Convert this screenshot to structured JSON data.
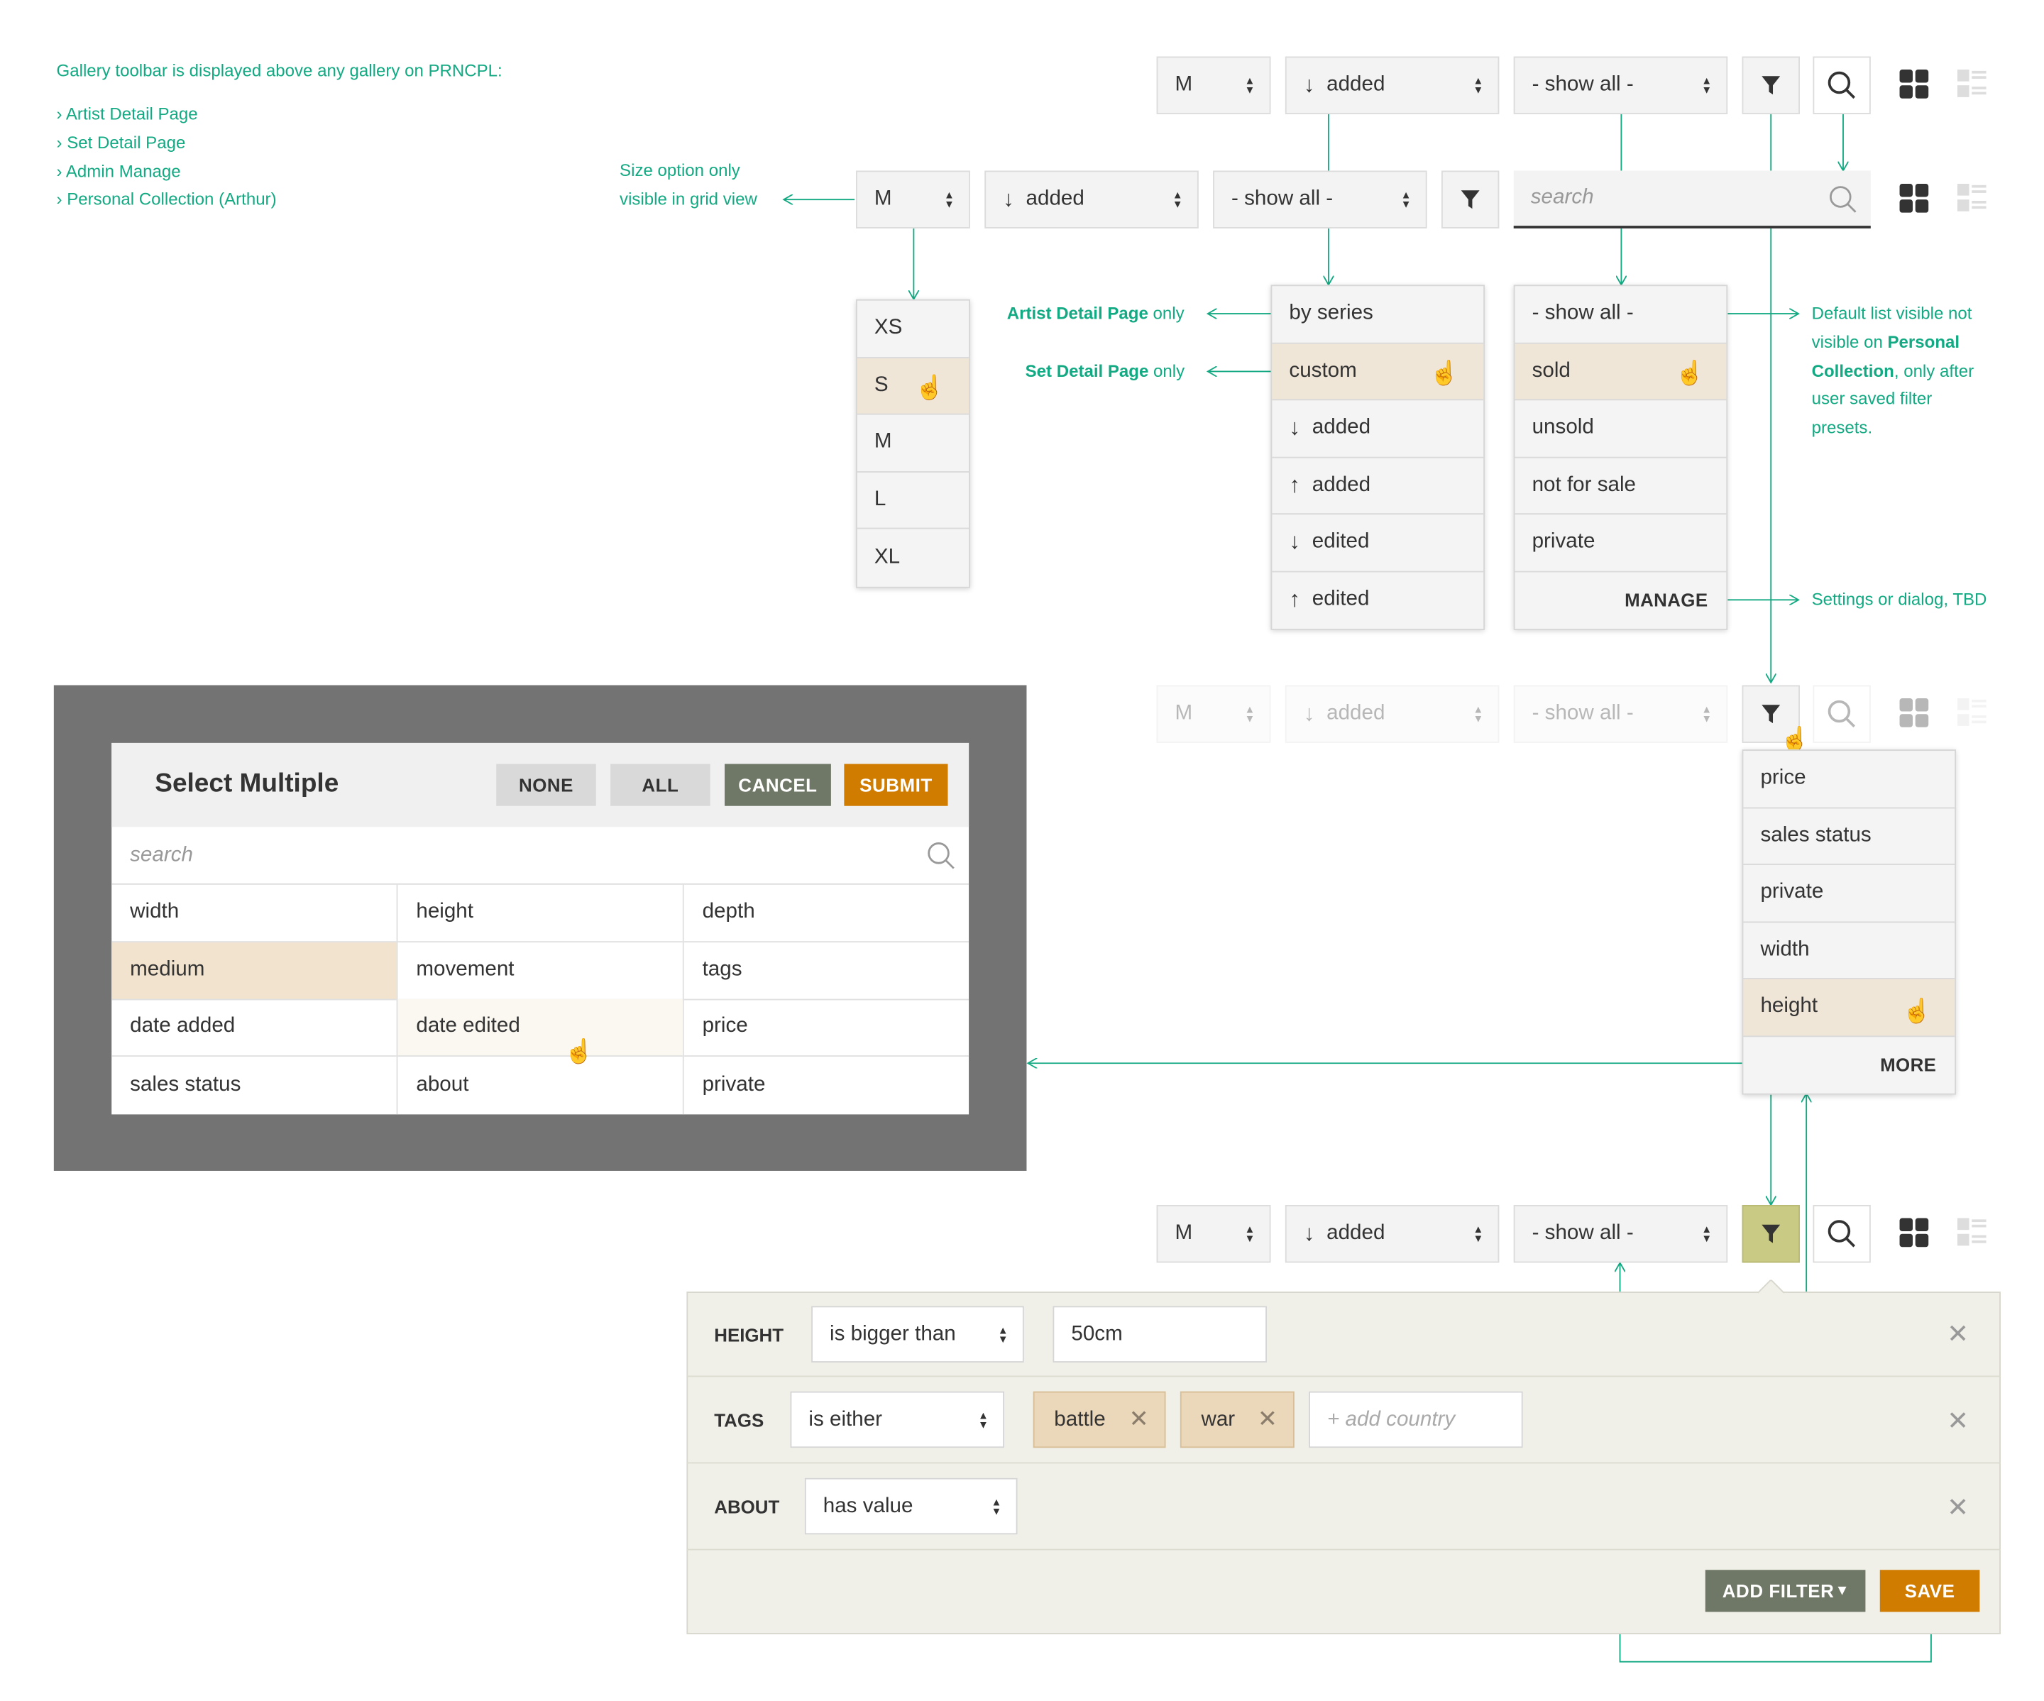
{
  "notes": {
    "gallery_intro": "Gallery toolbar is displayed above any gallery on PRNCPL:",
    "gallery_pages": [
      "› Artist Detail Page",
      "› Set Detail Page",
      "› Admin Manage",
      "› Personal Collection (Arthur)"
    ],
    "size_option_1": "Size option only",
    "size_option_2": "visible in grid view",
    "artist_only_bold": "Artist Detail Page",
    "artist_only_rest": " only",
    "set_only_bold": "Set Detail Page",
    "set_only_rest": " only",
    "default_list_1": "Default list visible not",
    "default_list_2a": "visible on ",
    "default_list_2b": "Personal",
    "default_list_3a": "Collection",
    "default_list_3b": ", only after",
    "default_list_4": "user saved filter",
    "default_list_5": "presets.",
    "settings_dialog": "Settings or dialog, TBD"
  },
  "toolbar": {
    "size_value": "M",
    "sort_value": "added",
    "sort_icon": "arrow-down-icon",
    "show_value": "- show all -",
    "search_placeholder": "search",
    "filter_icon": "funnel-icon",
    "search_icon": "magnifier-icon",
    "grid_icon": "grid-view-icon",
    "list_icon": "list-view-icon",
    "filter_active_color": "#c9cb85"
  },
  "size_dropdown": [
    "XS",
    "S",
    "M",
    "L",
    "XL"
  ],
  "sort_dropdown": [
    {
      "label": "by series",
      "arrow": ""
    },
    {
      "label": "custom",
      "arrow": ""
    },
    {
      "label": "added",
      "arrow": "↓"
    },
    {
      "label": "added",
      "arrow": "↑"
    },
    {
      "label": "edited",
      "arrow": "↓"
    },
    {
      "label": "edited",
      "arrow": "↑"
    }
  ],
  "show_dropdown": {
    "items": [
      "- show all -",
      "sold",
      "unsold",
      "not for sale",
      "private"
    ],
    "manage": "MANAGE"
  },
  "filter_dropdown": {
    "items": [
      "price",
      "sales status",
      "private",
      "width",
      "height"
    ],
    "more": "MORE"
  },
  "select_multiple": {
    "title": "Select Multiple",
    "none": "NONE",
    "all": "ALL",
    "cancel": "CANCEL",
    "submit": "SUBMIT",
    "search_placeholder": "search",
    "cells": [
      "width",
      "height",
      "depth",
      "medium",
      "movement",
      "tags",
      "date added",
      "date edited",
      "price",
      "sales status",
      "about",
      "private"
    ]
  },
  "filter_panel": {
    "rows": [
      {
        "label": "HEIGHT",
        "operator": "is bigger than",
        "value": "50cm"
      },
      {
        "label": "TAGS",
        "operator": "is either",
        "tags": [
          "battle",
          "war"
        ],
        "add_placeholder": "+ add country"
      },
      {
        "label": "ABOUT",
        "operator": "has value"
      }
    ],
    "add_filter": "ADD FILTER",
    "save": "SAVE"
  },
  "colors": {
    "accent_green": "#13a982",
    "highlight": "#f0e6d8",
    "cancel_btn": "#6f7766",
    "submit_btn": "#d07c00",
    "overlay": "#737373"
  }
}
